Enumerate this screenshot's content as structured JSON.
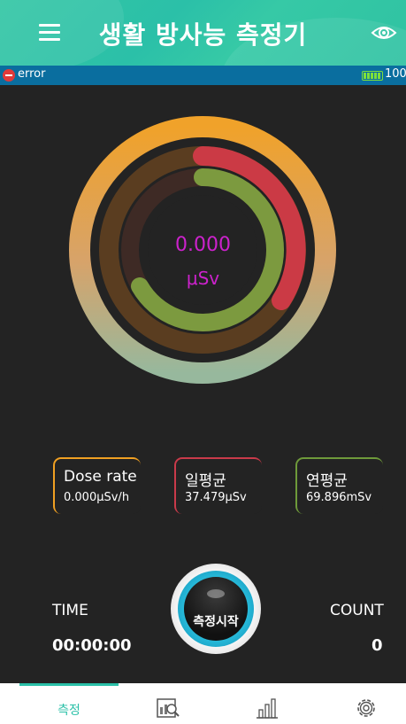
{
  "header": {
    "title": "생활 방사능 측정기",
    "menu_icon": "menu-icon",
    "eye_icon": "eye-icon",
    "color": "#2bc0a8"
  },
  "status": {
    "error_text": "error",
    "battery_level": "100",
    "error_icon": "error-icon",
    "battery_icon": "battery-icon"
  },
  "gauge": {
    "value": "0.000",
    "unit": "μSv",
    "value_color": "#cc22cc"
  },
  "cards": [
    {
      "label": "Dose rate",
      "value": "0.000μSv/h",
      "color": "#f0a022"
    },
    {
      "label": "일평균",
      "value": "37.479μSv",
      "color": "#c93a4a"
    },
    {
      "label": "연평균",
      "value": "69.896mSv",
      "color": "#6e9a3a"
    }
  ],
  "time": {
    "label": "TIME",
    "value": "00:00:00"
  },
  "count": {
    "label": "COUNT",
    "value": "0"
  },
  "start_button": {
    "label": "측정시작"
  },
  "nav": {
    "tabs": [
      {
        "label": "측정",
        "icon": "measure-tab",
        "active": true
      },
      {
        "label": "",
        "icon": "search-report-icon",
        "active": false
      },
      {
        "label": "",
        "icon": "bar-chart-icon",
        "active": false
      },
      {
        "label": "",
        "icon": "gear-icon",
        "active": false
      }
    ]
  }
}
